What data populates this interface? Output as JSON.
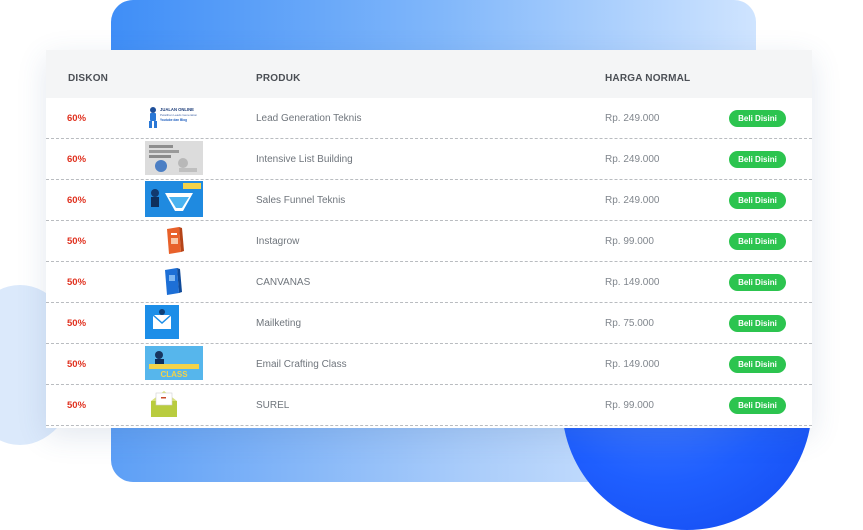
{
  "table": {
    "headers": {
      "discount": "DISKON",
      "product": "PRODUK",
      "price": "HARGA NORMAL"
    },
    "rows": [
      {
        "discount": "60%",
        "product": "Lead Generation Teknis",
        "price": "Rp. 249.000",
        "button": "Beli Disini",
        "thumb": "lead-generation-thumbnail"
      },
      {
        "discount": "60%",
        "product": "Intensive List Building",
        "price": "Rp. 249.000",
        "button": "Beli Disini",
        "thumb": "list-building-thumbnail"
      },
      {
        "discount": "60%",
        "product": "Sales Funnel Teknis",
        "price": "Rp. 249.000",
        "button": "Beli Disini",
        "thumb": "sales-funnel-thumbnail"
      },
      {
        "discount": "50%",
        "product": "Instagrow",
        "price": "Rp. 99.000",
        "button": "Beli Disini",
        "thumb": "instagrow-thumbnail"
      },
      {
        "discount": "50%",
        "product": "CANVANAS",
        "price": "Rp. 149.000",
        "button": "Beli Disini",
        "thumb": "canvanas-thumbnail"
      },
      {
        "discount": "50%",
        "product": "Mailketing",
        "price": "Rp. 75.000",
        "button": "Beli Disini",
        "thumb": "mailketing-thumbnail"
      },
      {
        "discount": "50%",
        "product": "Email Crafting Class",
        "price": "Rp. 149.000",
        "button": "Beli Disini",
        "thumb": "email-crafting-thumbnail"
      },
      {
        "discount": "50%",
        "product": "SUREL",
        "price": "Rp. 99.000",
        "button": "Beli Disini",
        "thumb": "surel-thumbnail"
      }
    ]
  },
  "thumb_texts": {
    "lead_line1": "JUALAN ONLINE",
    "lead_line2": "Pelatihan Leads Generation",
    "lead_line3": "Youtube dan Blog",
    "email_class": "CLASS"
  },
  "colors": {
    "discount": "#e0311f",
    "button": "#2cc44f",
    "header_bg": "#f4f5f6",
    "background_blue": "#3f8ef7",
    "circle_blue": "#1f5fff"
  }
}
